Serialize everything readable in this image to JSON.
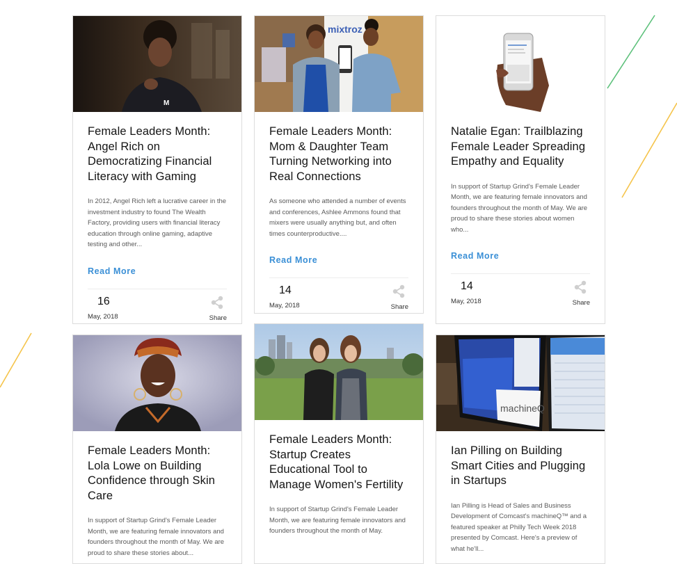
{
  "page": {
    "colors": {
      "accent_link": "#3a8fd6",
      "deco_green": "#5cc07a",
      "deco_yellow": "#f5c44b",
      "card_border": "#dcdcdc"
    }
  },
  "cards": [
    {
      "image_alt": "Portrait of Angel Rich",
      "title": "Female Leaders Month: Angel Rich on Democratizing Financial Literacy with Gaming",
      "excerpt": "In 2012, Angel Rich left a lucrative career in the investment industry to found The Wealth Factory, providing users with financial literacy education through online gaming, adaptive testing and other...",
      "read_more": "Read More",
      "day": "16",
      "month": "May, 2018",
      "share": "Share",
      "share_icon": "share-icon"
    },
    {
      "image_alt": "Ashlee Ammons and mother in front of mixtroz banner",
      "image_text": "mixtroz",
      "title": "Female Leaders Month: Mom & Daughter Team Turning Networking into Real Connections",
      "excerpt": "As someone who attended a number of events and conferences, Ashlee Ammons found that mixers were usually anything but, and often times counterproductive....",
      "read_more": "Read More",
      "day": "14",
      "month": "May, 2018",
      "share": "Share",
      "share_icon": "share-icon"
    },
    {
      "image_alt": "Hand holding a smartphone",
      "title": "Natalie Egan: Trailblazing Female Leader Spreading Empathy and Equality",
      "excerpt": "In support of Startup Grind's Female Leader Month, we are featuring female innovators and founders throughout the month of May. We are proud to share these stories about women who...",
      "read_more": "Read More",
      "day": "14",
      "month": "May, 2018",
      "share": "Share",
      "share_icon": "share-icon"
    },
    {
      "image_alt": "Portrait of Lola Lowe",
      "title": "Female Leaders Month: Lola Lowe on Building Confidence through Skin Care",
      "excerpt": "In support of Startup Grind's Female Leader Month, we are featuring female innovators and founders throughout the month of May. We are proud to share these stories about..."
    },
    {
      "image_alt": "Two women in a park with city skyline",
      "title": "Female Leaders Month: Startup Creates Educational Tool to Manage Women's Fertility",
      "excerpt": "In support of Startup Grind's Female Leader Month, we are featuring female innovators and founders throughout the month of May."
    },
    {
      "image_alt": "Monitors showing machineQ dashboard",
      "image_text": "machineQ",
      "title": "Ian Pilling on Building Smart Cities and Plugging in Startups",
      "excerpt": "Ian Pilling is Head of Sales and Business Development of Comcast's machineQ™ and a featured speaker at Philly Tech Week 2018 presented by Comcast. Here's a preview of what he'll..."
    }
  ]
}
